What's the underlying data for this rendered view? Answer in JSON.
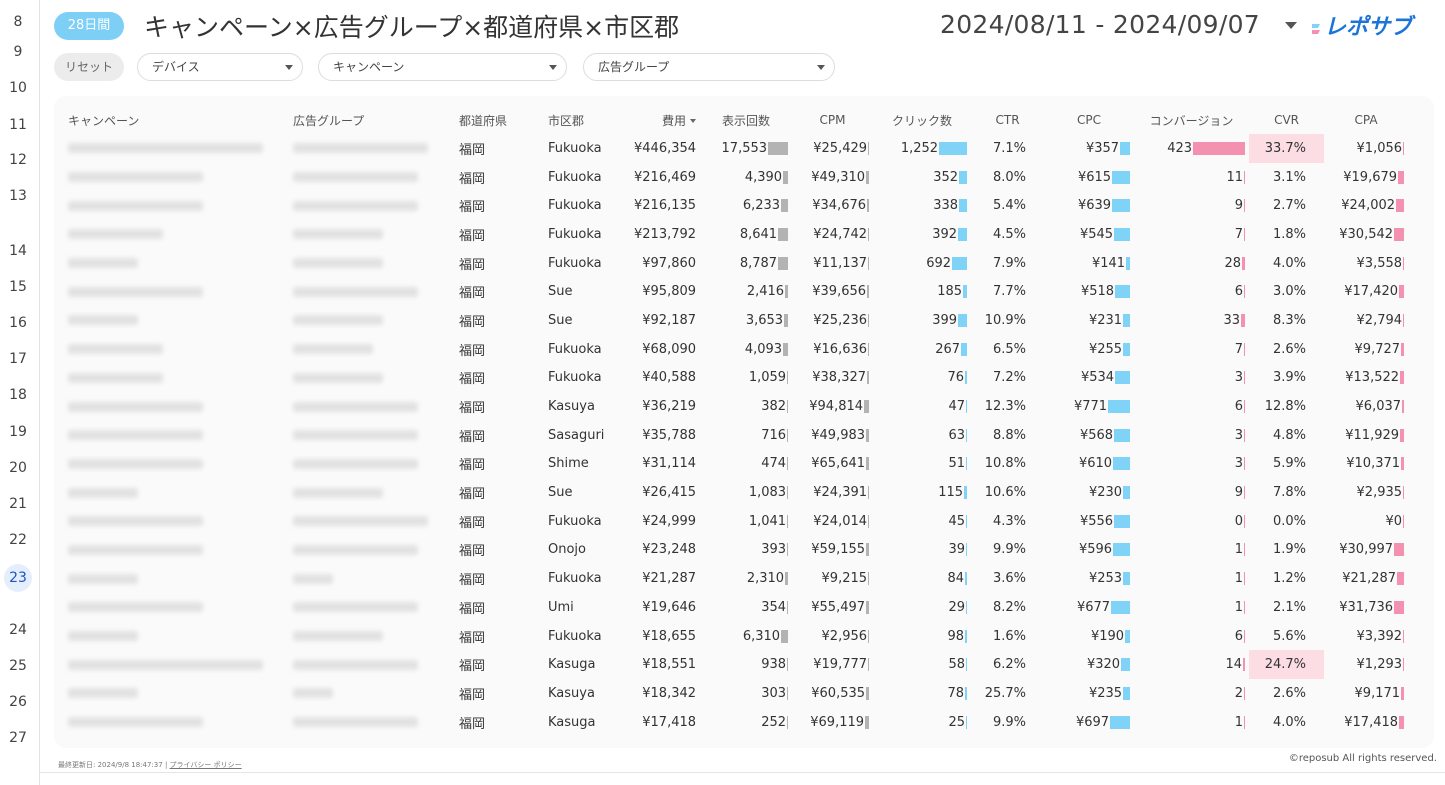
{
  "gutter": {
    "lines": [
      "8",
      "9",
      "10",
      "11",
      "12",
      "13",
      "14",
      "15",
      "16",
      "17",
      "18",
      "19",
      "20",
      "21",
      "22",
      "23",
      "24",
      "25",
      "26",
      "27"
    ],
    "active": "23"
  },
  "header": {
    "period_badge": "28日間",
    "title": "キャンペーン×広告グループ×都道府県×市区郡",
    "date_range": "2024/08/11 - 2024/09/07",
    "logo_icon": "reposub-logo",
    "logo_text": "レポサブ",
    "accent_color": "#7dcff5"
  },
  "filters": {
    "reset_label": "リセット",
    "device": "デバイス",
    "campaign": "キャンペーン",
    "ad_group": "広告グループ"
  },
  "table": {
    "columns": [
      "キャンペーン",
      "広告グループ",
      "都道府県",
      "市区郡",
      "費用",
      "表示回数",
      "CPM",
      "クリック数",
      "CTR",
      "CPC",
      "コンバージョン",
      "CVR",
      "CPA"
    ],
    "rows": [
      {
        "pref": "福岡",
        "city": "Fukuoka",
        "cost": "¥446,354",
        "imp": "17,553",
        "imp_n": 17553,
        "cpm": "¥25,429",
        "cpm_n": 25429,
        "clicks": "1,252",
        "clicks_n": 1252,
        "ctr": "7.1%",
        "cpc": "¥357",
        "cpc_n": 357,
        "conv": "423",
        "conv_n": 423,
        "cvr": "33.7%",
        "cvr_hl": true,
        "cpa": "¥1,056",
        "cpa_n": 1056
      },
      {
        "pref": "福岡",
        "city": "Fukuoka",
        "cost": "¥216,469",
        "imp": "4,390",
        "imp_n": 4390,
        "cpm": "¥49,310",
        "cpm_n": 49310,
        "clicks": "352",
        "clicks_n": 352,
        "ctr": "8.0%",
        "cpc": "¥615",
        "cpc_n": 615,
        "conv": "11",
        "conv_n": 11,
        "cvr": "3.1%",
        "cvr_hl": false,
        "cpa": "¥19,679",
        "cpa_n": 19679
      },
      {
        "pref": "福岡",
        "city": "Fukuoka",
        "cost": "¥216,135",
        "imp": "6,233",
        "imp_n": 6233,
        "cpm": "¥34,676",
        "cpm_n": 34676,
        "clicks": "338",
        "clicks_n": 338,
        "ctr": "5.4%",
        "cpc": "¥639",
        "cpc_n": 639,
        "conv": "9",
        "conv_n": 9,
        "cvr": "2.7%",
        "cvr_hl": false,
        "cpa": "¥24,002",
        "cpa_n": 24002
      },
      {
        "pref": "福岡",
        "city": "Fukuoka",
        "cost": "¥213,792",
        "imp": "8,641",
        "imp_n": 8641,
        "cpm": "¥24,742",
        "cpm_n": 24742,
        "clicks": "392",
        "clicks_n": 392,
        "ctr": "4.5%",
        "cpc": "¥545",
        "cpc_n": 545,
        "conv": "7",
        "conv_n": 7,
        "cvr": "1.8%",
        "cvr_hl": false,
        "cpa": "¥30,542",
        "cpa_n": 30542
      },
      {
        "pref": "福岡",
        "city": "Fukuoka",
        "cost": "¥97,860",
        "imp": "8,787",
        "imp_n": 8787,
        "cpm": "¥11,137",
        "cpm_n": 11137,
        "clicks": "692",
        "clicks_n": 692,
        "ctr": "7.9%",
        "cpc": "¥141",
        "cpc_n": 141,
        "conv": "28",
        "conv_n": 28,
        "cvr": "4.0%",
        "cvr_hl": false,
        "cpa": "¥3,558",
        "cpa_n": 3558
      },
      {
        "pref": "福岡",
        "city": "Sue",
        "cost": "¥95,809",
        "imp": "2,416",
        "imp_n": 2416,
        "cpm": "¥39,656",
        "cpm_n": 39656,
        "clicks": "185",
        "clicks_n": 185,
        "ctr": "7.7%",
        "cpc": "¥518",
        "cpc_n": 518,
        "conv": "6",
        "conv_n": 6,
        "cvr": "3.0%",
        "cvr_hl": false,
        "cpa": "¥17,420",
        "cpa_n": 17420
      },
      {
        "pref": "福岡",
        "city": "Sue",
        "cost": "¥92,187",
        "imp": "3,653",
        "imp_n": 3653,
        "cpm": "¥25,236",
        "cpm_n": 25236,
        "clicks": "399",
        "clicks_n": 399,
        "ctr": "10.9%",
        "cpc": "¥231",
        "cpc_n": 231,
        "conv": "33",
        "conv_n": 33,
        "cvr": "8.3%",
        "cvr_hl": false,
        "cpa": "¥2,794",
        "cpa_n": 2794
      },
      {
        "pref": "福岡",
        "city": "Fukuoka",
        "cost": "¥68,090",
        "imp": "4,093",
        "imp_n": 4093,
        "cpm": "¥16,636",
        "cpm_n": 16636,
        "clicks": "267",
        "clicks_n": 267,
        "ctr": "6.5%",
        "cpc": "¥255",
        "cpc_n": 255,
        "conv": "7",
        "conv_n": 7,
        "cvr": "2.6%",
        "cvr_hl": false,
        "cpa": "¥9,727",
        "cpa_n": 9727
      },
      {
        "pref": "福岡",
        "city": "Fukuoka",
        "cost": "¥40,588",
        "imp": "1,059",
        "imp_n": 1059,
        "cpm": "¥38,327",
        "cpm_n": 38327,
        "clicks": "76",
        "clicks_n": 76,
        "ctr": "7.2%",
        "cpc": "¥534",
        "cpc_n": 534,
        "conv": "3",
        "conv_n": 3,
        "cvr": "3.9%",
        "cvr_hl": false,
        "cpa": "¥13,522",
        "cpa_n": 13522
      },
      {
        "pref": "福岡",
        "city": "Kasuya",
        "cost": "¥36,219",
        "imp": "382",
        "imp_n": 382,
        "cpm": "¥94,814",
        "cpm_n": 94814,
        "clicks": "47",
        "clicks_n": 47,
        "ctr": "12.3%",
        "cpc": "¥771",
        "cpc_n": 771,
        "conv": "6",
        "conv_n": 6,
        "cvr": "12.8%",
        "cvr_hl": false,
        "cpa": "¥6,037",
        "cpa_n": 6037
      },
      {
        "pref": "福岡",
        "city": "Sasaguri",
        "cost": "¥35,788",
        "imp": "716",
        "imp_n": 716,
        "cpm": "¥49,983",
        "cpm_n": 49983,
        "clicks": "63",
        "clicks_n": 63,
        "ctr": "8.8%",
        "cpc": "¥568",
        "cpc_n": 568,
        "conv": "3",
        "conv_n": 3,
        "cvr": "4.8%",
        "cvr_hl": false,
        "cpa": "¥11,929",
        "cpa_n": 11929
      },
      {
        "pref": "福岡",
        "city": "Shime",
        "cost": "¥31,114",
        "imp": "474",
        "imp_n": 474,
        "cpm": "¥65,641",
        "cpm_n": 65641,
        "clicks": "51",
        "clicks_n": 51,
        "ctr": "10.8%",
        "cpc": "¥610",
        "cpc_n": 610,
        "conv": "3",
        "conv_n": 3,
        "cvr": "5.9%",
        "cvr_hl": false,
        "cpa": "¥10,371",
        "cpa_n": 10371
      },
      {
        "pref": "福岡",
        "city": "Sue",
        "cost": "¥26,415",
        "imp": "1,083",
        "imp_n": 1083,
        "cpm": "¥24,391",
        "cpm_n": 24391,
        "clicks": "115",
        "clicks_n": 115,
        "ctr": "10.6%",
        "cpc": "¥230",
        "cpc_n": 230,
        "conv": "9",
        "conv_n": 9,
        "cvr": "7.8%",
        "cvr_hl": false,
        "cpa": "¥2,935",
        "cpa_n": 2935
      },
      {
        "pref": "福岡",
        "city": "Fukuoka",
        "cost": "¥24,999",
        "imp": "1,041",
        "imp_n": 1041,
        "cpm": "¥24,014",
        "cpm_n": 24014,
        "clicks": "45",
        "clicks_n": 45,
        "ctr": "4.3%",
        "cpc": "¥556",
        "cpc_n": 556,
        "conv": "0",
        "conv_n": 0,
        "cvr": "0.0%",
        "cvr_hl": false,
        "cpa": "¥0",
        "cpa_n": 0
      },
      {
        "pref": "福岡",
        "city": "Onojo",
        "cost": "¥23,248",
        "imp": "393",
        "imp_n": 393,
        "cpm": "¥59,155",
        "cpm_n": 59155,
        "clicks": "39",
        "clicks_n": 39,
        "ctr": "9.9%",
        "cpc": "¥596",
        "cpc_n": 596,
        "conv": "1",
        "conv_n": 1,
        "cvr": "1.9%",
        "cvr_hl": false,
        "cpa": "¥30,997",
        "cpa_n": 30997
      },
      {
        "pref": "福岡",
        "city": "Fukuoka",
        "cost": "¥21,287",
        "imp": "2,310",
        "imp_n": 2310,
        "cpm": "¥9,215",
        "cpm_n": 9215,
        "clicks": "84",
        "clicks_n": 84,
        "ctr": "3.6%",
        "cpc": "¥253",
        "cpc_n": 253,
        "conv": "1",
        "conv_n": 1,
        "cvr": "1.2%",
        "cvr_hl": false,
        "cpa": "¥21,287",
        "cpa_n": 21287
      },
      {
        "pref": "福岡",
        "city": "Umi",
        "cost": "¥19,646",
        "imp": "354",
        "imp_n": 354,
        "cpm": "¥55,497",
        "cpm_n": 55497,
        "clicks": "29",
        "clicks_n": 29,
        "ctr": "8.2%",
        "cpc": "¥677",
        "cpc_n": 677,
        "conv": "1",
        "conv_n": 1,
        "cvr": "2.1%",
        "cvr_hl": false,
        "cpa": "¥31,736",
        "cpa_n": 31736
      },
      {
        "pref": "福岡",
        "city": "Fukuoka",
        "cost": "¥18,655",
        "imp": "6,310",
        "imp_n": 6310,
        "cpm": "¥2,956",
        "cpm_n": 2956,
        "clicks": "98",
        "clicks_n": 98,
        "ctr": "1.6%",
        "cpc": "¥190",
        "cpc_n": 190,
        "conv": "6",
        "conv_n": 6,
        "cvr": "5.6%",
        "cvr_hl": false,
        "cpa": "¥3,392",
        "cpa_n": 3392
      },
      {
        "pref": "福岡",
        "city": "Kasuga",
        "cost": "¥18,551",
        "imp": "938",
        "imp_n": 938,
        "cpm": "¥19,777",
        "cpm_n": 19777,
        "clicks": "58",
        "clicks_n": 58,
        "ctr": "6.2%",
        "cpc": "¥320",
        "cpc_n": 320,
        "conv": "14",
        "conv_n": 14,
        "cvr": "24.7%",
        "cvr_hl": true,
        "cpa": "¥1,293",
        "cpa_n": 1293
      },
      {
        "pref": "福岡",
        "city": "Kasuya",
        "cost": "¥18,342",
        "imp": "303",
        "imp_n": 303,
        "cpm": "¥60,535",
        "cpm_n": 60535,
        "clicks": "78",
        "clicks_n": 78,
        "ctr": "25.7%",
        "cpc": "¥235",
        "cpc_n": 235,
        "conv": "2",
        "conv_n": 2,
        "cvr": "2.6%",
        "cvr_hl": false,
        "cpa": "¥9,171",
        "cpa_n": 9171
      },
      {
        "pref": "福岡",
        "city": "Kasuga",
        "cost": "¥17,418",
        "imp": "252",
        "imp_n": 252,
        "cpm": "¥69,119",
        "cpm_n": 69119,
        "clicks": "25",
        "clicks_n": 25,
        "ctr": "9.9%",
        "cpc": "¥697",
        "cpc_n": 697,
        "conv": "1",
        "conv_n": 1,
        "cvr": "4.0%",
        "cvr_hl": false,
        "cpa": "¥17,418",
        "cpa_n": 17418
      }
    ]
  },
  "colors": {
    "bar_gray": "#b3b3b3",
    "bar_blue": "#7fd3f7",
    "bar_pink": "#f490b0",
    "cvr_highlight": "#fbdde3"
  },
  "footer": {
    "updated_label": "最終更新日:",
    "updated_value": "2024/9/8 18:47:37",
    "separator": "|",
    "privacy_link": "プライバシー ポリシー",
    "copyright": "©reposub All rights reserved."
  }
}
